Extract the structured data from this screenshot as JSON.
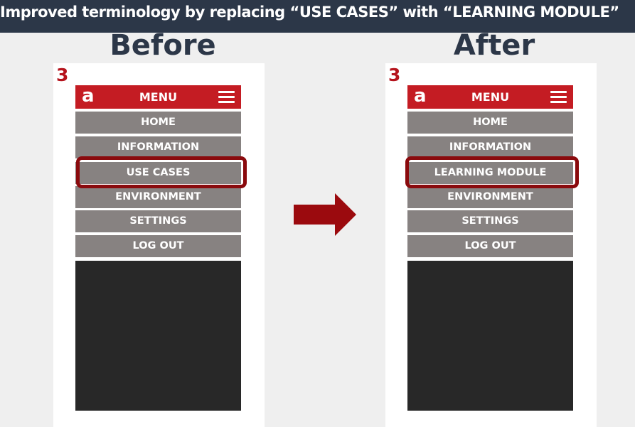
{
  "banner": {
    "title": "Improved terminology by replacing “USE CASES” with “LEARNING MODULE”"
  },
  "headings": {
    "before": "Before",
    "after": "After"
  },
  "colors": {
    "banner": "#2c3748",
    "brand_red": "#c41c23",
    "menu_gray": "#878281",
    "highlight": "#8a0a0d",
    "content_dark": "#282828",
    "arrow": "#9b0a0e"
  },
  "before": {
    "step_number": "3",
    "logo": "a",
    "menu_title": "MENU",
    "menu_icon": "hamburger-icon",
    "items": [
      "HOME",
      "INFORMATION",
      "USE CASES",
      "ENVIRONMENT",
      "SETTINGS",
      "LOG OUT"
    ],
    "highlighted_item": "USE CASES"
  },
  "after": {
    "step_number": "3",
    "logo": "a",
    "menu_title": "MENU",
    "menu_icon": "hamburger-icon",
    "items": [
      "HOME",
      "INFORMATION",
      "LEARNING MODULE",
      "ENVIRONMENT",
      "SETTINGS",
      "LOG OUT"
    ],
    "highlighted_item": "LEARNING MODULE"
  },
  "transition_icon": "right-arrow-icon"
}
